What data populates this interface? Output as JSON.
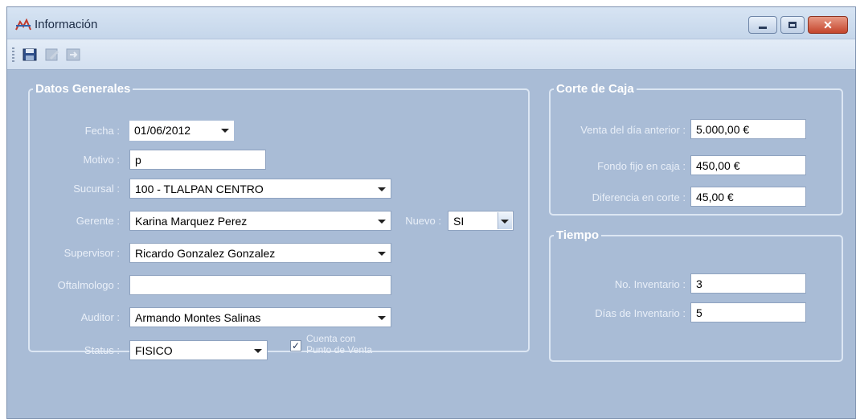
{
  "window": {
    "title": "Información",
    "controls": {
      "minimize": "minimize-icon",
      "maximize": "maximize-icon",
      "close": "close-icon"
    }
  },
  "toolbar": {
    "buttons": [
      "save-icon",
      "edit-icon",
      "exit-icon"
    ]
  },
  "datos_generales": {
    "legend": "Datos Generales",
    "fecha": {
      "label": "Fecha :",
      "value": "01/06/2012"
    },
    "motivo": {
      "label": "Motivo :",
      "value": "p"
    },
    "sucursal": {
      "label": "Sucursal :",
      "value": "100 - TLALPAN CENTRO"
    },
    "gerente": {
      "label": "Gerente :",
      "value": "Karina Marquez Perez"
    },
    "nuevo": {
      "label": "Nuevo :",
      "value": "SI"
    },
    "supervisor": {
      "label": "Supervisor :",
      "value": "Ricardo Gonzalez Gonzalez"
    },
    "oftalmologo": {
      "label": "Oftalmologo :",
      "value": ""
    },
    "auditor": {
      "label": "Auditor :",
      "value": "Armando Montes Salinas"
    },
    "status": {
      "label": "Status :",
      "value": "FISICO"
    },
    "punto_venta": {
      "line1": "Cuenta con",
      "line2": "Punto de Venta",
      "checked": true,
      "mark": "✓"
    }
  },
  "corte_de_caja": {
    "legend": "Corte de Caja",
    "venta_anterior": {
      "label": "Venta del día anterior :",
      "value": "5.000,00 €"
    },
    "fondo_fijo": {
      "label": "Fondo fijo en caja :",
      "value": "450,00 €"
    },
    "diferencia": {
      "label": "Diferencia en corte :",
      "value": "45,00 €"
    }
  },
  "tiempo": {
    "legend": "Tiempo",
    "no_inventario": {
      "label": "No. Inventario :",
      "value": "3"
    },
    "dias_inventario": {
      "label": "Días de Inventario :",
      "value": "5"
    }
  }
}
